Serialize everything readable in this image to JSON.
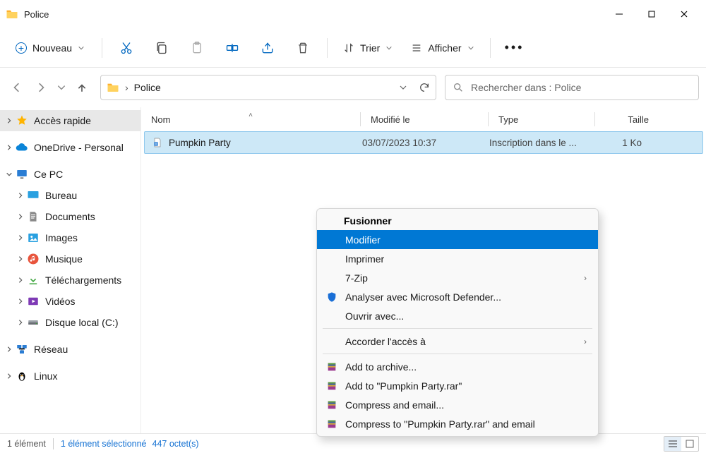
{
  "title": "Police",
  "toolbar": {
    "new_label": "Nouveau",
    "sort_label": "Trier",
    "view_label": "Afficher"
  },
  "address": {
    "current": "Police"
  },
  "search": {
    "placeholder": "Rechercher dans : Police"
  },
  "sidebar": {
    "quick_access": "Accès rapide",
    "onedrive": "OneDrive - Personal",
    "this_pc": "Ce PC",
    "desktop": "Bureau",
    "documents": "Documents",
    "images": "Images",
    "music": "Musique",
    "downloads": "Téléchargements",
    "videos": "Vidéos",
    "disk": "Disque local (C:)",
    "network": "Réseau",
    "linux": "Linux"
  },
  "columns": {
    "name": "Nom",
    "modified": "Modifié le",
    "type": "Type",
    "size": "Taille"
  },
  "file": {
    "name": "Pumpkin Party",
    "modified": "03/07/2023 10:37",
    "type": "Inscription dans le ...",
    "size": "1 Ko"
  },
  "menu": {
    "header": "Fusionner",
    "modify": "Modifier",
    "print": "Imprimer",
    "sevenzip": "7-Zip",
    "defender": "Analyser avec Microsoft Defender...",
    "openwith": "Ouvrir avec...",
    "grantaccess": "Accorder l'accès à",
    "addarchive": "Add to archive...",
    "addrar": "Add to \"Pumpkin Party.rar\"",
    "compressmail": "Compress and email...",
    "compressrarmail": "Compress to \"Pumpkin Party.rar\" and email"
  },
  "status": {
    "count": "1 élément",
    "selection": "1 élément sélectionné",
    "size": "447 octet(s)"
  }
}
